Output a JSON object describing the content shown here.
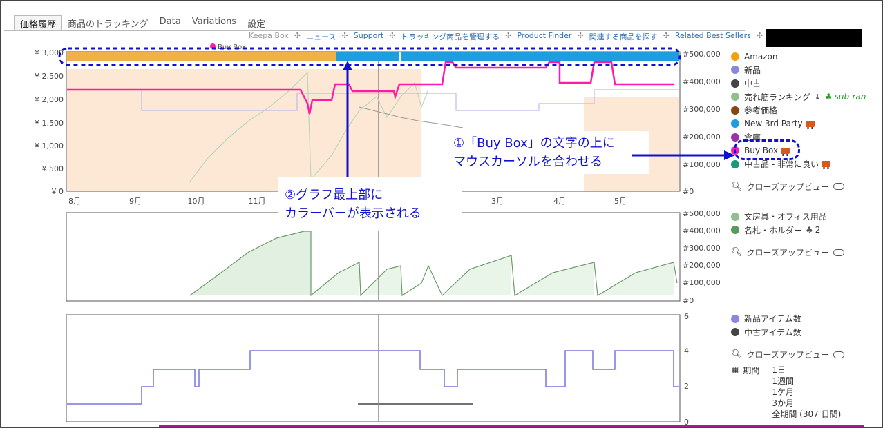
{
  "tabs": [
    {
      "label": "価格履歴"
    },
    {
      "label": "商品のトラッキング"
    },
    {
      "label": "Data"
    },
    {
      "label": "Variations"
    },
    {
      "label": "設定"
    }
  ],
  "links": [
    "Keepa Box",
    "ニュース",
    "Support",
    "トラッキング商品を管理する",
    "Product Finder",
    "関連する商品を探す",
    "Related Best Sellers"
  ],
  "chart1": {
    "left_ticks": [
      "¥ 3,000",
      "¥ 2,500",
      "¥ 2,000",
      "¥ 1,500",
      "¥ 1,000",
      "¥ 500",
      "¥ 0"
    ],
    "right_ticks": [
      "#500,000",
      "#400,000",
      "#300,000",
      "#200,000",
      "#100,000",
      "#0"
    ],
    "months": [
      "8月",
      "9月",
      "10月",
      "11月",
      "3月",
      "4月",
      "5月"
    ],
    "buybox_label": "Buy Box"
  },
  "chart2": {
    "right_ticks": [
      "#500,000",
      "#400,000",
      "#300,000",
      "#200,000",
      "#100,000",
      "#0"
    ]
  },
  "chart3": {
    "right_ticks": [
      "6",
      "4",
      "2",
      "0"
    ]
  },
  "legend1": {
    "items": [
      {
        "label": "Amazon",
        "color": "#f2a10a"
      },
      {
        "label": "新品",
        "color": "#8888dd"
      },
      {
        "label": "中古",
        "color": "#444444"
      },
      {
        "label": "売れ筋ランキング",
        "color": "#8fbf8f",
        "extra": "sub-ran"
      },
      {
        "label": "参考価格",
        "color": "#8b4513"
      },
      {
        "label": "New 3rd Party",
        "color": "#1e9ee0"
      },
      {
        "label": "倉庫",
        "color": "#9933aa"
      },
      {
        "label": "Buy Box",
        "color": "#ff1aa8"
      },
      {
        "label": "中古品 - 非常に良い",
        "color": "#159a7a"
      }
    ],
    "closeup": "クローズアップビュー"
  },
  "legend2": {
    "items": [
      {
        "label": "文房具・オフィス用品",
        "color": "#8fbf8f"
      },
      {
        "label": "名札・ホルダー",
        "color": "#5a9a5a",
        "count": "2"
      }
    ],
    "closeup": "クローズアップビュー"
  },
  "legend3": {
    "items": [
      {
        "label": "新品アイテム数",
        "color": "#8888dd"
      },
      {
        "label": "中古アイテム数",
        "color": "#444444"
      }
    ],
    "closeup": "クローズアップビュー",
    "period_label": "期間",
    "periods": [
      "1日",
      "1週間",
      "1ケ月",
      "3か月",
      "全期間 (307 日間)"
    ]
  },
  "callouts": {
    "one_line1": "①「Buy Box」の文字の上に",
    "one_line2": "マウスカーソルを合わせる",
    "two_line1": "②グラフ最上部に",
    "two_line2": "カラーバーが表示される"
  }
}
